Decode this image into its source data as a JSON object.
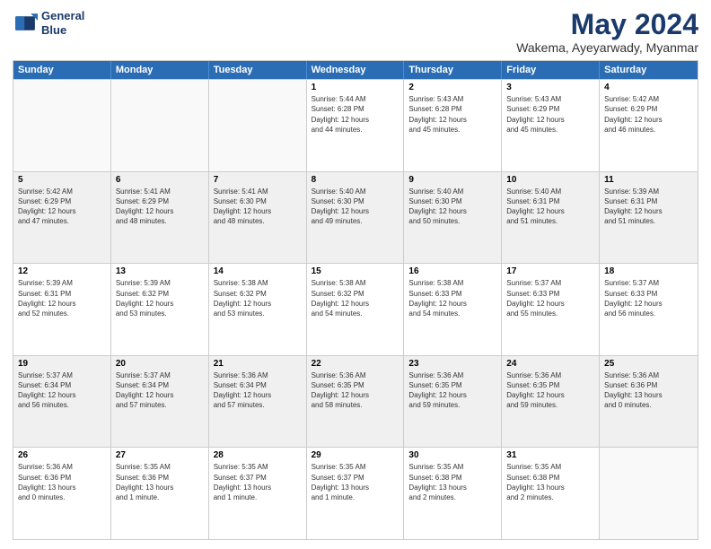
{
  "header": {
    "logo_line1": "General",
    "logo_line2": "Blue",
    "month": "May 2024",
    "location": "Wakema, Ayeyarwady, Myanmar"
  },
  "weekdays": [
    "Sunday",
    "Monday",
    "Tuesday",
    "Wednesday",
    "Thursday",
    "Friday",
    "Saturday"
  ],
  "rows": [
    [
      {
        "day": "",
        "info": "",
        "empty": true
      },
      {
        "day": "",
        "info": "",
        "empty": true
      },
      {
        "day": "",
        "info": "",
        "empty": true
      },
      {
        "day": "1",
        "info": "Sunrise: 5:44 AM\nSunset: 6:28 PM\nDaylight: 12 hours\nand 44 minutes."
      },
      {
        "day": "2",
        "info": "Sunrise: 5:43 AM\nSunset: 6:28 PM\nDaylight: 12 hours\nand 45 minutes."
      },
      {
        "day": "3",
        "info": "Sunrise: 5:43 AM\nSunset: 6:29 PM\nDaylight: 12 hours\nand 45 minutes."
      },
      {
        "day": "4",
        "info": "Sunrise: 5:42 AM\nSunset: 6:29 PM\nDaylight: 12 hours\nand 46 minutes."
      }
    ],
    [
      {
        "day": "5",
        "info": "Sunrise: 5:42 AM\nSunset: 6:29 PM\nDaylight: 12 hours\nand 47 minutes."
      },
      {
        "day": "6",
        "info": "Sunrise: 5:41 AM\nSunset: 6:29 PM\nDaylight: 12 hours\nand 48 minutes."
      },
      {
        "day": "7",
        "info": "Sunrise: 5:41 AM\nSunset: 6:30 PM\nDaylight: 12 hours\nand 48 minutes."
      },
      {
        "day": "8",
        "info": "Sunrise: 5:40 AM\nSunset: 6:30 PM\nDaylight: 12 hours\nand 49 minutes."
      },
      {
        "day": "9",
        "info": "Sunrise: 5:40 AM\nSunset: 6:30 PM\nDaylight: 12 hours\nand 50 minutes."
      },
      {
        "day": "10",
        "info": "Sunrise: 5:40 AM\nSunset: 6:31 PM\nDaylight: 12 hours\nand 51 minutes."
      },
      {
        "day": "11",
        "info": "Sunrise: 5:39 AM\nSunset: 6:31 PM\nDaylight: 12 hours\nand 51 minutes."
      }
    ],
    [
      {
        "day": "12",
        "info": "Sunrise: 5:39 AM\nSunset: 6:31 PM\nDaylight: 12 hours\nand 52 minutes."
      },
      {
        "day": "13",
        "info": "Sunrise: 5:39 AM\nSunset: 6:32 PM\nDaylight: 12 hours\nand 53 minutes."
      },
      {
        "day": "14",
        "info": "Sunrise: 5:38 AM\nSunset: 6:32 PM\nDaylight: 12 hours\nand 53 minutes."
      },
      {
        "day": "15",
        "info": "Sunrise: 5:38 AM\nSunset: 6:32 PM\nDaylight: 12 hours\nand 54 minutes."
      },
      {
        "day": "16",
        "info": "Sunrise: 5:38 AM\nSunset: 6:33 PM\nDaylight: 12 hours\nand 54 minutes."
      },
      {
        "day": "17",
        "info": "Sunrise: 5:37 AM\nSunset: 6:33 PM\nDaylight: 12 hours\nand 55 minutes."
      },
      {
        "day": "18",
        "info": "Sunrise: 5:37 AM\nSunset: 6:33 PM\nDaylight: 12 hours\nand 56 minutes."
      }
    ],
    [
      {
        "day": "19",
        "info": "Sunrise: 5:37 AM\nSunset: 6:34 PM\nDaylight: 12 hours\nand 56 minutes."
      },
      {
        "day": "20",
        "info": "Sunrise: 5:37 AM\nSunset: 6:34 PM\nDaylight: 12 hours\nand 57 minutes."
      },
      {
        "day": "21",
        "info": "Sunrise: 5:36 AM\nSunset: 6:34 PM\nDaylight: 12 hours\nand 57 minutes."
      },
      {
        "day": "22",
        "info": "Sunrise: 5:36 AM\nSunset: 6:35 PM\nDaylight: 12 hours\nand 58 minutes."
      },
      {
        "day": "23",
        "info": "Sunrise: 5:36 AM\nSunset: 6:35 PM\nDaylight: 12 hours\nand 59 minutes."
      },
      {
        "day": "24",
        "info": "Sunrise: 5:36 AM\nSunset: 6:35 PM\nDaylight: 12 hours\nand 59 minutes."
      },
      {
        "day": "25",
        "info": "Sunrise: 5:36 AM\nSunset: 6:36 PM\nDaylight: 13 hours\nand 0 minutes."
      }
    ],
    [
      {
        "day": "26",
        "info": "Sunrise: 5:36 AM\nSunset: 6:36 PM\nDaylight: 13 hours\nand 0 minutes."
      },
      {
        "day": "27",
        "info": "Sunrise: 5:35 AM\nSunset: 6:36 PM\nDaylight: 13 hours\nand 1 minute."
      },
      {
        "day": "28",
        "info": "Sunrise: 5:35 AM\nSunset: 6:37 PM\nDaylight: 13 hours\nand 1 minute."
      },
      {
        "day": "29",
        "info": "Sunrise: 5:35 AM\nSunset: 6:37 PM\nDaylight: 13 hours\nand 1 minute."
      },
      {
        "day": "30",
        "info": "Sunrise: 5:35 AM\nSunset: 6:38 PM\nDaylight: 13 hours\nand 2 minutes."
      },
      {
        "day": "31",
        "info": "Sunrise: 5:35 AM\nSunset: 6:38 PM\nDaylight: 13 hours\nand 2 minutes."
      },
      {
        "day": "",
        "info": "",
        "empty": true
      }
    ]
  ]
}
